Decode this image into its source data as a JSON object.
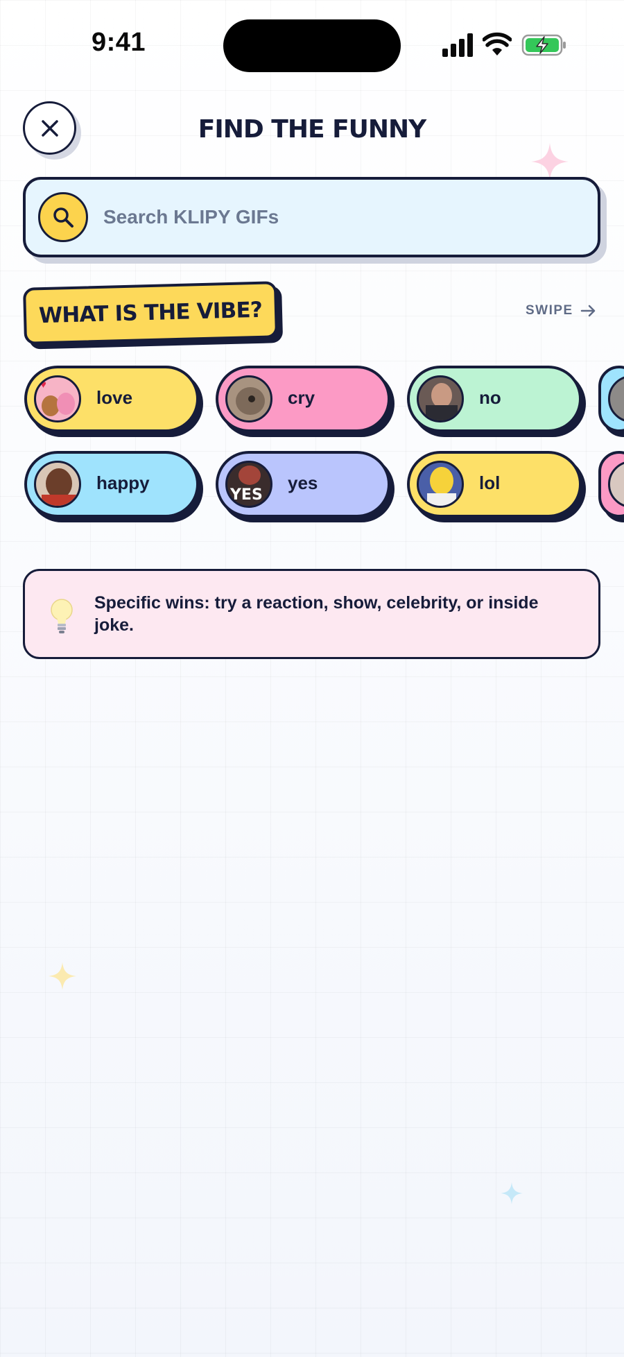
{
  "status_bar": {
    "time": "9:41"
  },
  "header": {
    "title": "FIND THE FUNNY",
    "close_icon": "close-icon"
  },
  "search": {
    "placeholder": "Search KLIPY GIFs",
    "value": ""
  },
  "vibes": {
    "heading": "WHAT IS THE VIBE?",
    "swipe_label": "SWIPE",
    "chips": [
      {
        "label": "love",
        "color": "#fde068"
      },
      {
        "label": "cry",
        "color": "#fc9ac5"
      },
      {
        "label": "no",
        "color": "#bcf3d3"
      },
      {
        "label": "happy",
        "color": "#9fe3fd"
      },
      {
        "label": "yes",
        "color": "#bac5fd"
      },
      {
        "label": "lol",
        "color": "#fde068"
      }
    ]
  },
  "tip": {
    "text": "Specific wins: try a reaction, show, celebrity, or inside joke."
  },
  "colors": {
    "accent_yellow": "#fdd95a",
    "ink": "#161c3a",
    "search_bg": "#e6f5fe",
    "tip_bg": "#fde8f1"
  }
}
